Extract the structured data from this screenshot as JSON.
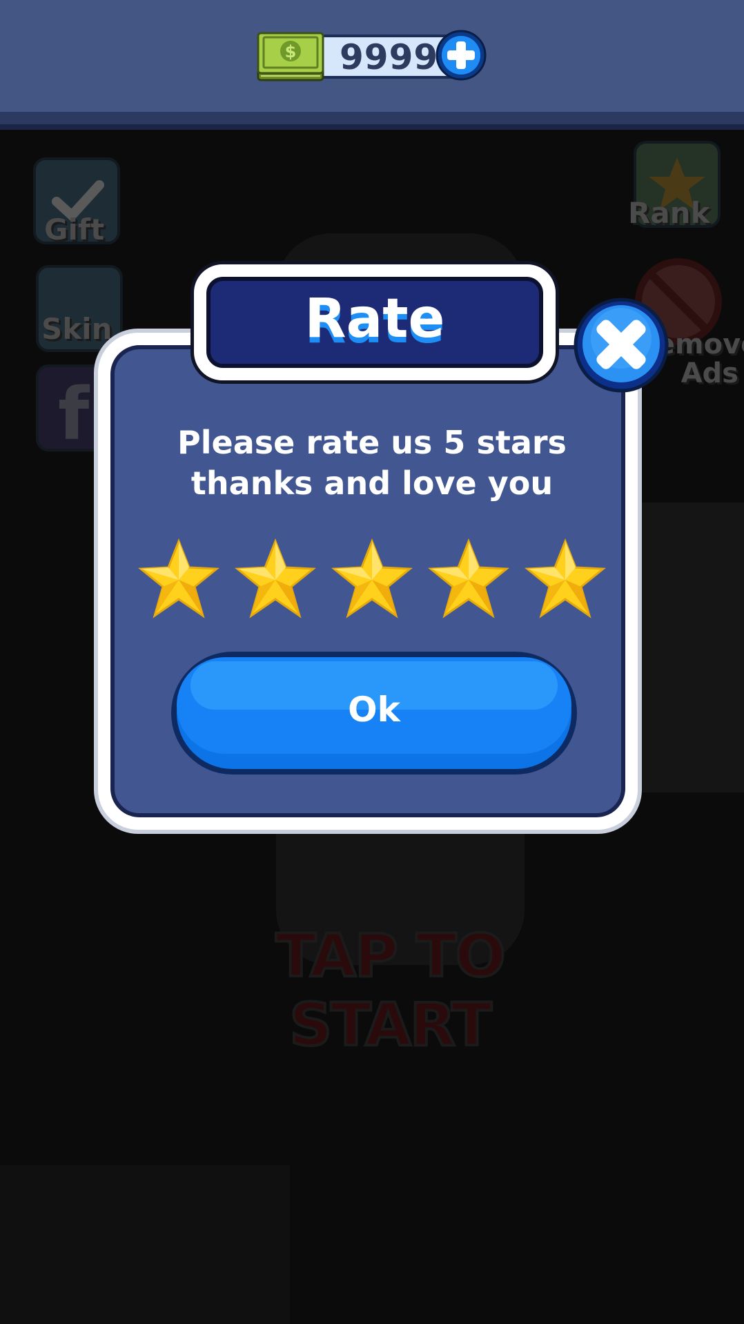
{
  "header": {
    "currency_amount": "9999",
    "currency_icon": "cash-stack-icon",
    "add_icon": "plus-icon"
  },
  "background": {
    "left_buttons": [
      {
        "label": "Gift",
        "icon": "checkmark-icon"
      },
      {
        "label": "Skin",
        "icon": "skin-icon"
      },
      {
        "label": "",
        "icon": "facebook-icon"
      }
    ],
    "right_buttons": [
      {
        "label": "Rank",
        "icon": "trophy-icon"
      },
      {
        "label": "Remove Ads",
        "icon": "no-ads-icon"
      }
    ],
    "tap_to_start": "TAP TO START"
  },
  "dialog": {
    "title": "Rate",
    "message_line1": "Please rate us 5 stars",
    "message_line2": "thanks and love you",
    "rating": 5,
    "max_rating": 5,
    "ok_label": "Ok",
    "close_icon": "close-icon",
    "star_icon": "star-icon"
  },
  "colors": {
    "topbar": "#435684",
    "dialog_fill": "#425691",
    "title_fill": "#1d2b77",
    "ok_button": "#1486f7",
    "star": "#ffd11c"
  }
}
